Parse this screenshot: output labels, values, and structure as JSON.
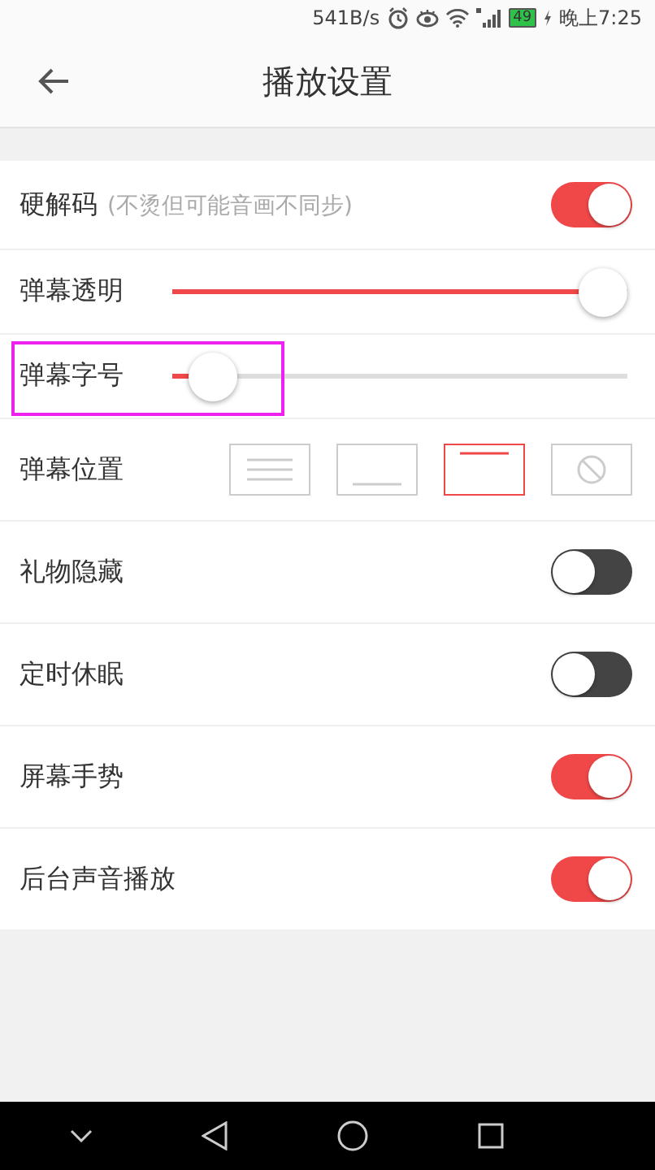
{
  "status_bar": {
    "speed": "541B/s",
    "battery": "49",
    "time": "晚上7:25"
  },
  "header": {
    "title": "播放设置"
  },
  "settings": [
    {
      "kind": "toggle",
      "label": "硬解码",
      "hint": "(不烫但可能音画不同步)",
      "on": true,
      "highlighted": false
    },
    {
      "kind": "slider",
      "label": "弹幕透明",
      "level": 1.0,
      "highlighted": false
    },
    {
      "kind": "slider",
      "label": "弹幕字号",
      "level": 0.04,
      "highlighted": true
    },
    {
      "kind": "position",
      "label": "弹幕位置",
      "options": [
        {
          "kind": "full",
          "selected": false
        },
        {
          "kind": "bottom",
          "selected": false
        },
        {
          "kind": "top",
          "selected": true
        },
        {
          "kind": "off",
          "selected": false
        }
      ],
      "highlighted": false
    },
    {
      "kind": "toggle",
      "label": "礼物隐藏",
      "on": false,
      "highlighted": false
    },
    {
      "kind": "toggle",
      "label": "定时休眠",
      "on": false,
      "highlighted": false
    },
    {
      "kind": "toggle",
      "label": "屏幕手势",
      "on": true,
      "highlighted": false
    },
    {
      "kind": "toggle",
      "label": "后台声音播放",
      "on": true,
      "highlighted": false
    }
  ]
}
